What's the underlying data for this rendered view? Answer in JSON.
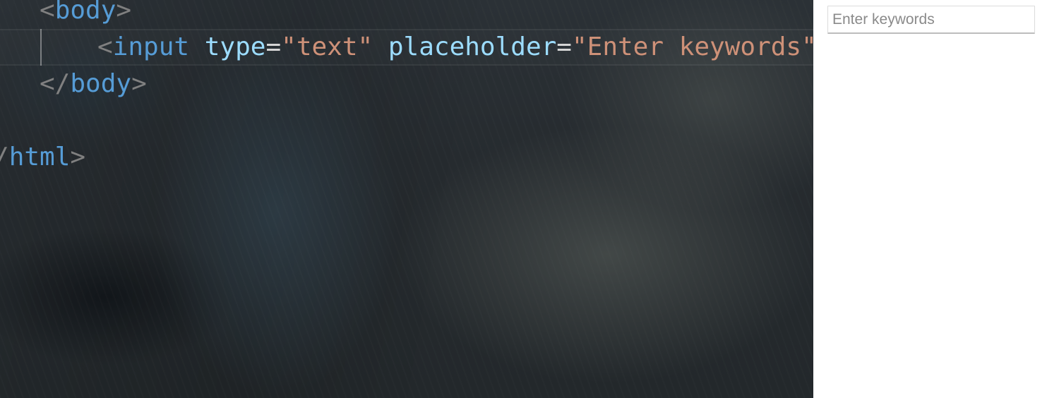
{
  "editor": {
    "lines": [
      {
        "tokens": [
          {
            "type": "punct",
            "text": "<"
          },
          {
            "type": "tag",
            "text": "body"
          },
          {
            "type": "punct",
            "text": ">"
          }
        ]
      },
      {
        "tokens": [
          {
            "type": "punct",
            "text": "<"
          },
          {
            "type": "tag",
            "text": "input"
          },
          {
            "type": "space",
            "text": " "
          },
          {
            "type": "attr",
            "text": "type"
          },
          {
            "type": "eq",
            "text": "="
          },
          {
            "type": "str",
            "text": "\"text\""
          },
          {
            "type": "space",
            "text": " "
          },
          {
            "type": "attr",
            "text": "placeholder"
          },
          {
            "type": "eq",
            "text": "="
          },
          {
            "type": "str",
            "text": "\"Enter keywords\""
          },
          {
            "type": "punct",
            "text": ">"
          }
        ]
      },
      {
        "tokens": [
          {
            "type": "punct",
            "text": "</"
          },
          {
            "type": "tag",
            "text": "body"
          },
          {
            "type": "punct",
            "text": ">"
          }
        ]
      },
      {
        "tokens": [
          {
            "type": "punct",
            "text": "/"
          },
          {
            "type": "tag",
            "text": "html"
          },
          {
            "type": "punct",
            "text": ">"
          }
        ]
      }
    ],
    "colors": {
      "punct": "#808080",
      "tag": "#569cd6",
      "attr": "#9cdcfe",
      "eq": "#d4d4d4",
      "str": "#ce9178"
    }
  },
  "preview": {
    "input": {
      "value": "",
      "placeholder": "Enter keywords"
    }
  }
}
